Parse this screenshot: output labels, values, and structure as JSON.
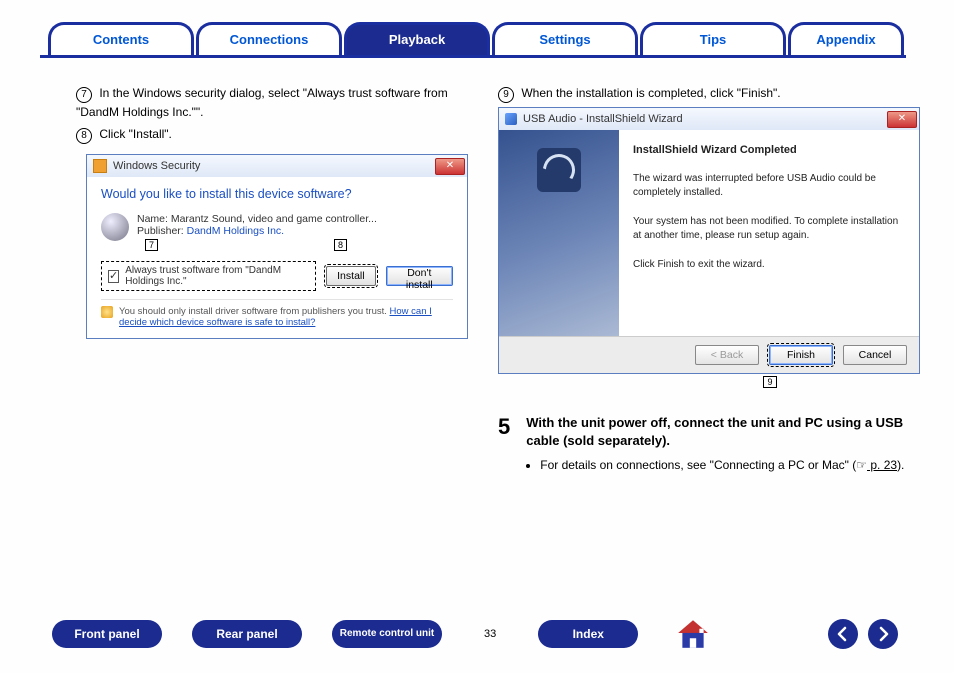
{
  "tabs": {
    "contents": "Contents",
    "connections": "Connections",
    "playback": "Playback",
    "settings": "Settings",
    "tips": "Tips",
    "appendix": "Appendix"
  },
  "left": {
    "step7_num": "7",
    "step7_text": "In the Windows security dialog, select \"Always trust software from \"DandM Holdings Inc.\"\".",
    "step8_num": "8",
    "step8_text": "Click \"Install\"."
  },
  "win_sec": {
    "title": "Windows Security",
    "close": "✕",
    "question": "Would you like to install this device software?",
    "dev_name": "Name: Marantz Sound, video and game controller...",
    "dev_pub_label": "Publisher: ",
    "dev_pub_name": "DandM Holdings Inc.",
    "callout7": "7",
    "callout8": "8",
    "checkbox_label": "Always trust software from \"DandM Holdings Inc.\"",
    "install_btn": "Install",
    "noinstall_btn": "Don't install",
    "footnote_text": "You should only install driver software from publishers you trust. ",
    "footnote_link": "How can I decide which device software is safe to install?"
  },
  "right": {
    "step9_num": "9",
    "step9_text": "When the installation is completed, click \"Finish\"."
  },
  "is_dlg": {
    "title": "USB Audio - InstallShield Wizard",
    "close": "✕",
    "heading": "InstallShield Wizard Completed",
    "p1": "The wizard was interrupted before USB Audio could be completely installed.",
    "p2": "Your system has not been modified. To complete installation at another time, please run setup again.",
    "p3": "Click Finish to exit the wizard.",
    "back": "< Back",
    "finish": "Finish",
    "cancel": "Cancel",
    "callout9": "9"
  },
  "step5": {
    "num": "5",
    "heading": "With the unit power off, connect the unit and PC using a USB cable (sold separately).",
    "bullet_prefix": "For details on connections, see \"Connecting a PC or Mac\" (",
    "page_icon": "☞",
    "page_ref": " p. 23",
    "bullet_suffix": ")."
  },
  "bottom": {
    "front": "Front panel",
    "rear": "Rear panel",
    "remote": "Remote control unit",
    "page": "33",
    "index": "Index"
  }
}
